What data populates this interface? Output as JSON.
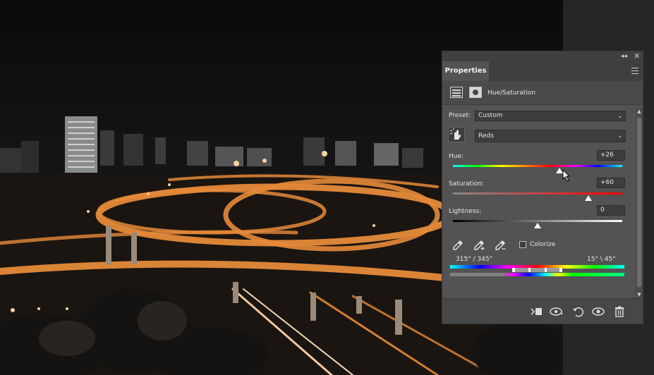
{
  "panel": {
    "tab_label": "Properties",
    "adjustment_title": "Hue/Saturation",
    "preset_label": "Preset:",
    "preset_value": "Custom",
    "range_value": "Reds",
    "hue_label": "Hue:",
    "hue_value": "+26",
    "hue_level": 0.63,
    "saturation_label": "Saturation:",
    "saturation_value": "+60",
    "saturation_level": 0.8,
    "lightness_label": "Lightness:",
    "lightness_value": "0",
    "lightness_level": 0.5,
    "colorize_label": "Colorize",
    "colorize_checked": false,
    "range_left": "315° / 345°",
    "range_right": "15° \\ 45°"
  },
  "icons": {
    "collapse": "double-chevron-left-icon",
    "close": "close-icon",
    "menu": "menu-icon",
    "adjustment": "hue-saturation-adjustment-icon",
    "mask": "layer-mask-icon",
    "hand": "targeted-adjustment-hand-icon",
    "eyedropper": "eyedropper-icon",
    "eyedropper_plus": "eyedropper-plus-icon",
    "eyedropper_minus": "eyedropper-minus-icon",
    "clip": "clip-to-layer-icon",
    "view_previous": "view-previous-state-icon",
    "reset": "reset-icon",
    "visibility": "eye-icon",
    "delete": "trash-icon"
  },
  "colors": {
    "panel_bg": "#535353",
    "accent_orange": "#e58a3a"
  }
}
